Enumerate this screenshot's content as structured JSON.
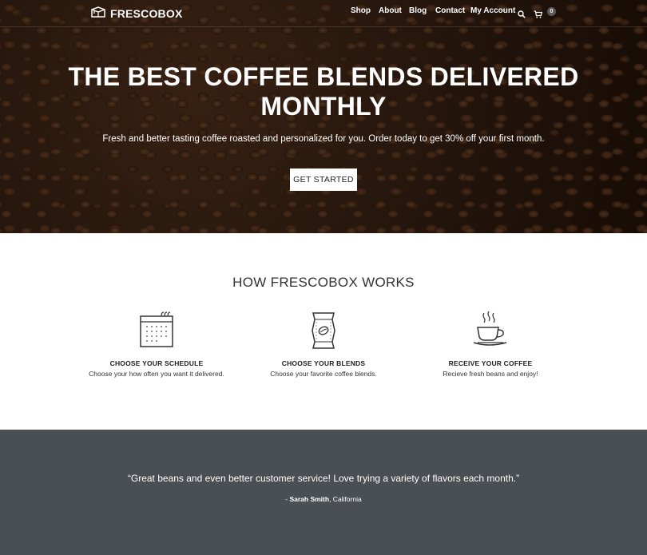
{
  "brand": {
    "name": "FRESCOBOX",
    "logo_icon": "box-icon"
  },
  "nav": {
    "items": [
      "Shop",
      "About",
      "Blog",
      "Contact",
      "My Account"
    ],
    "search_icon": "search-icon",
    "cart_icon": "cart-icon",
    "cart_count": "0"
  },
  "hero": {
    "title_line1": "THE BEST COFFEE BLENDS DELIVERED",
    "title_line2": "MONTHLY",
    "subtitle": "Fresh and better tasting coffee roasted and personalized for you. Order today to get 30% off your first month.",
    "cta": "GET STARTED"
  },
  "how": {
    "title": "HOW FRESCOBOX WORKS",
    "steps": [
      {
        "icon": "calendar-icon",
        "title": "CHOOSE YOUR SCHEDULE",
        "desc": "Choose your how often you want it delivered."
      },
      {
        "icon": "coffee-bag-icon",
        "title": "CHOOSE YOUR BLENDS",
        "desc": "Choose your favorite coffee blends."
      },
      {
        "icon": "coffee-cup-icon",
        "title": "RECEIVE YOUR COFFEE",
        "desc": "Recieve fresh beans and enjoy!"
      }
    ]
  },
  "testimonial": {
    "quote": "“Great beans and even better customer service! Love trying a variety of flavors each month.”",
    "prefix": "- ",
    "author": "Sarah Smith",
    "location": ", California"
  },
  "colors": {
    "testimonial_bg": "#4a4f53",
    "hero_bg": "#2a1a10"
  }
}
